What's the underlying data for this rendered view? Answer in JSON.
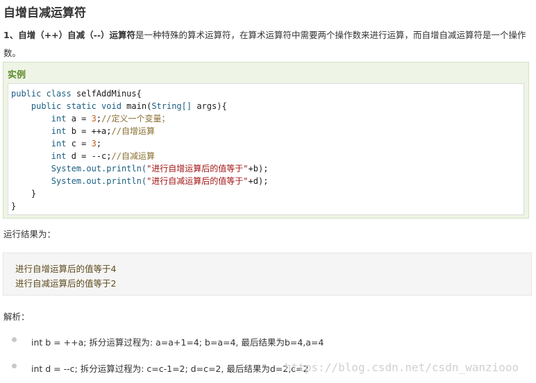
{
  "title": "自增自减运算符",
  "intro": {
    "num": "1、",
    "bold1": "自增（++）自减（--）运算符",
    "text": "是一种特殊的算术运算符，在算术运算符中需要两个操作数来进行运算，而自增自减运算符是一个操作数。"
  },
  "example": {
    "label": "实例",
    "code": {
      "l1_kw": "public class",
      "l1_name": " selfAddMinus{",
      "l2_kw": "public static void",
      "l2_name": " main(",
      "l2_type": "String[]",
      "l2_rest": " args){",
      "l3_type": "int",
      "l3_code": " a = ",
      "l3_num": "3",
      "l3_semi": ";",
      "l3_comment": "//定义一个变量；",
      "l4_type": "int",
      "l4_code": " b = ++a;",
      "l4_comment": "//自增运算",
      "l5_type": "int",
      "l5_code": " c = ",
      "l5_num": "3",
      "l5_semi": ";",
      "l6_type": "int",
      "l6_code": " d = --c;",
      "l6_comment": "//自减运算",
      "l7_call": "System.out.println(",
      "l7_str": "\"进行自增运算后的值等于\"",
      "l7_end": "+b);",
      "l8_call": "System.out.println(",
      "l8_str": "\"进行自减运算后的值等于\"",
      "l8_end": "+d);",
      "l9": "}",
      "l10": "}"
    }
  },
  "result_label": "运行结果为：",
  "output": [
    "进行自增运算后的值等于4",
    "进行自减运算后的值等于2"
  ],
  "analysis_label": "解析：",
  "analysis": [
    "int b = ++a; 拆分运算过程为: a=a+1=4; b=a=4, 最后结果为b=4,a=4",
    "int d = --c; 拆分运算过程为: c=c-1=2; d=c=2, 最后结果为d=2,c=2"
  ],
  "watermark": "https://blog.csdn.net/csdn_wanziooo"
}
